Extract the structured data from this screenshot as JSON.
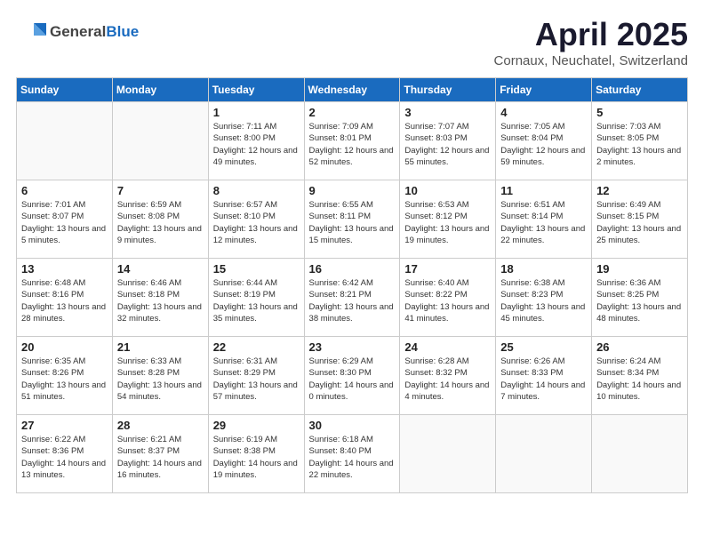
{
  "header": {
    "logo_general": "General",
    "logo_blue": "Blue",
    "month_title": "April 2025",
    "location": "Cornaux, Neuchatel, Switzerland"
  },
  "calendar": {
    "days_of_week": [
      "Sunday",
      "Monday",
      "Tuesday",
      "Wednesday",
      "Thursday",
      "Friday",
      "Saturday"
    ],
    "weeks": [
      [
        {
          "day": "",
          "info": ""
        },
        {
          "day": "",
          "info": ""
        },
        {
          "day": "1",
          "info": "Sunrise: 7:11 AM\nSunset: 8:00 PM\nDaylight: 12 hours and 49 minutes."
        },
        {
          "day": "2",
          "info": "Sunrise: 7:09 AM\nSunset: 8:01 PM\nDaylight: 12 hours and 52 minutes."
        },
        {
          "day": "3",
          "info": "Sunrise: 7:07 AM\nSunset: 8:03 PM\nDaylight: 12 hours and 55 minutes."
        },
        {
          "day": "4",
          "info": "Sunrise: 7:05 AM\nSunset: 8:04 PM\nDaylight: 12 hours and 59 minutes."
        },
        {
          "day": "5",
          "info": "Sunrise: 7:03 AM\nSunset: 8:05 PM\nDaylight: 13 hours and 2 minutes."
        }
      ],
      [
        {
          "day": "6",
          "info": "Sunrise: 7:01 AM\nSunset: 8:07 PM\nDaylight: 13 hours and 5 minutes."
        },
        {
          "day": "7",
          "info": "Sunrise: 6:59 AM\nSunset: 8:08 PM\nDaylight: 13 hours and 9 minutes."
        },
        {
          "day": "8",
          "info": "Sunrise: 6:57 AM\nSunset: 8:10 PM\nDaylight: 13 hours and 12 minutes."
        },
        {
          "day": "9",
          "info": "Sunrise: 6:55 AM\nSunset: 8:11 PM\nDaylight: 13 hours and 15 minutes."
        },
        {
          "day": "10",
          "info": "Sunrise: 6:53 AM\nSunset: 8:12 PM\nDaylight: 13 hours and 19 minutes."
        },
        {
          "day": "11",
          "info": "Sunrise: 6:51 AM\nSunset: 8:14 PM\nDaylight: 13 hours and 22 minutes."
        },
        {
          "day": "12",
          "info": "Sunrise: 6:49 AM\nSunset: 8:15 PM\nDaylight: 13 hours and 25 minutes."
        }
      ],
      [
        {
          "day": "13",
          "info": "Sunrise: 6:48 AM\nSunset: 8:16 PM\nDaylight: 13 hours and 28 minutes."
        },
        {
          "day": "14",
          "info": "Sunrise: 6:46 AM\nSunset: 8:18 PM\nDaylight: 13 hours and 32 minutes."
        },
        {
          "day": "15",
          "info": "Sunrise: 6:44 AM\nSunset: 8:19 PM\nDaylight: 13 hours and 35 minutes."
        },
        {
          "day": "16",
          "info": "Sunrise: 6:42 AM\nSunset: 8:21 PM\nDaylight: 13 hours and 38 minutes."
        },
        {
          "day": "17",
          "info": "Sunrise: 6:40 AM\nSunset: 8:22 PM\nDaylight: 13 hours and 41 minutes."
        },
        {
          "day": "18",
          "info": "Sunrise: 6:38 AM\nSunset: 8:23 PM\nDaylight: 13 hours and 45 minutes."
        },
        {
          "day": "19",
          "info": "Sunrise: 6:36 AM\nSunset: 8:25 PM\nDaylight: 13 hours and 48 minutes."
        }
      ],
      [
        {
          "day": "20",
          "info": "Sunrise: 6:35 AM\nSunset: 8:26 PM\nDaylight: 13 hours and 51 minutes."
        },
        {
          "day": "21",
          "info": "Sunrise: 6:33 AM\nSunset: 8:28 PM\nDaylight: 13 hours and 54 minutes."
        },
        {
          "day": "22",
          "info": "Sunrise: 6:31 AM\nSunset: 8:29 PM\nDaylight: 13 hours and 57 minutes."
        },
        {
          "day": "23",
          "info": "Sunrise: 6:29 AM\nSunset: 8:30 PM\nDaylight: 14 hours and 0 minutes."
        },
        {
          "day": "24",
          "info": "Sunrise: 6:28 AM\nSunset: 8:32 PM\nDaylight: 14 hours and 4 minutes."
        },
        {
          "day": "25",
          "info": "Sunrise: 6:26 AM\nSunset: 8:33 PM\nDaylight: 14 hours and 7 minutes."
        },
        {
          "day": "26",
          "info": "Sunrise: 6:24 AM\nSunset: 8:34 PM\nDaylight: 14 hours and 10 minutes."
        }
      ],
      [
        {
          "day": "27",
          "info": "Sunrise: 6:22 AM\nSunset: 8:36 PM\nDaylight: 14 hours and 13 minutes."
        },
        {
          "day": "28",
          "info": "Sunrise: 6:21 AM\nSunset: 8:37 PM\nDaylight: 14 hours and 16 minutes."
        },
        {
          "day": "29",
          "info": "Sunrise: 6:19 AM\nSunset: 8:38 PM\nDaylight: 14 hours and 19 minutes."
        },
        {
          "day": "30",
          "info": "Sunrise: 6:18 AM\nSunset: 8:40 PM\nDaylight: 14 hours and 22 minutes."
        },
        {
          "day": "",
          "info": ""
        },
        {
          "day": "",
          "info": ""
        },
        {
          "day": "",
          "info": ""
        }
      ]
    ]
  }
}
